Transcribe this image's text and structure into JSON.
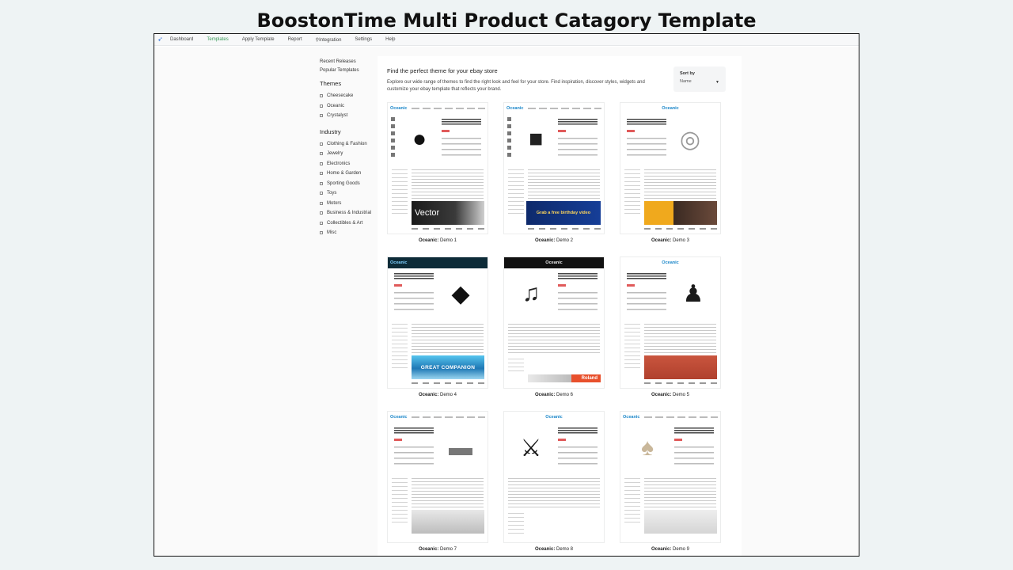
{
  "slide_title": "BoostonTime Multi Product Catagory Template",
  "topnav": {
    "items": [
      "Dashboard",
      "Templates",
      "Apply Template",
      "Report",
      "Integration",
      "Settings",
      "Help"
    ]
  },
  "sidebar": {
    "quick_links": [
      "Recent Releases",
      "Popular Templates"
    ],
    "themes_heading": "Themes",
    "themes": [
      "Cheesecake",
      "Oceanic",
      "Crystalyst"
    ],
    "industry_heading": "Industry",
    "industries": [
      "Clothing & Fashion",
      "Jewelry",
      "Electronics",
      "Home & Garden",
      "Sporting Goods",
      "Toys",
      "Motors",
      "Business & Industrial",
      "Collectibles & Art",
      "Misc"
    ]
  },
  "main": {
    "headline": "Find the perfect theme for your ebay store",
    "description": "Explore our wide range of themes to find the right look and feel for your store. Find inspiration, discover styles, widgets and customize your ebay template that reflects your brand.",
    "sort_label": "Sort by",
    "sort_value": "Name"
  },
  "templates": [
    {
      "theme": "Oceanic:",
      "demo": "Demo 1",
      "logo": "Oceanic",
      "banner": "Vector"
    },
    {
      "theme": "Oceanic:",
      "demo": "Demo 2",
      "logo": "Oceanic",
      "banner": "Grab a free birthday video"
    },
    {
      "theme": "Oceanic:",
      "demo": "Demo 3",
      "logo": "Oceanic",
      "banner": ""
    },
    {
      "theme": "Oceanic:",
      "demo": "Demo 4",
      "logo": "Oceanic",
      "banner": "GREAT COMPANION"
    },
    {
      "theme": "Oceanic:",
      "demo": "Demo 6",
      "logo": "Oceanic",
      "banner": "Roland"
    },
    {
      "theme": "Oceanic:",
      "demo": "Demo 5",
      "logo": "Oceanic",
      "banner": ""
    },
    {
      "theme": "Oceanic:",
      "demo": "Demo 7",
      "logo": "Oceanic",
      "banner": ""
    },
    {
      "theme": "Oceanic:",
      "demo": "Demo 8",
      "logo": "Oceanic",
      "banner": ""
    },
    {
      "theme": "Oceanic:",
      "demo": "Demo 9",
      "logo": "Oceanic",
      "banner": ""
    }
  ],
  "colors": {
    "accent_green": "#3a9b5a",
    "oceanic_blue": "#1a86c9",
    "price_red": "#e05a5a"
  }
}
